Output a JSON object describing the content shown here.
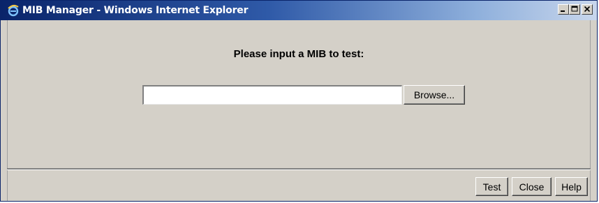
{
  "window": {
    "title": "MIB Manager - Windows Internet Explorer",
    "icon": "ie-icon",
    "controls": [
      "minimize-icon",
      "maximize-icon",
      "close-icon"
    ]
  },
  "main": {
    "prompt": "Please input a MIB to test:",
    "file_input": {
      "value": "",
      "placeholder": ""
    },
    "browse_label": "Browse..."
  },
  "footer": {
    "test_label": "Test",
    "close_label": "Close",
    "help_label": "Help"
  },
  "colors": {
    "titlebar_start": "#0a246a",
    "titlebar_end": "#c8d6ec",
    "window_bg": "#d4d0c8"
  }
}
